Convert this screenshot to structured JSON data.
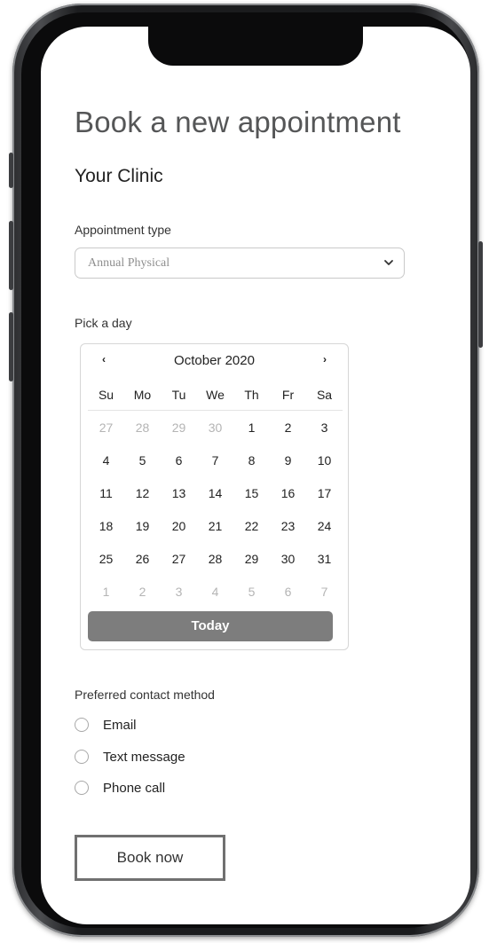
{
  "page": {
    "title": "Book a new appointment",
    "clinic": "Your Clinic"
  },
  "appointment_type": {
    "label": "Appointment type",
    "selected": "Annual Physical"
  },
  "date_picker": {
    "label": "Pick a day",
    "month_label": "October 2020",
    "prev_symbol": "‹",
    "next_symbol": "›",
    "weekdays": [
      "Su",
      "Mo",
      "Tu",
      "We",
      "Th",
      "Fr",
      "Sa"
    ],
    "weeks": [
      [
        {
          "d": "27",
          "muted": true
        },
        {
          "d": "28",
          "muted": true
        },
        {
          "d": "29",
          "muted": true
        },
        {
          "d": "30",
          "muted": true
        },
        {
          "d": "1"
        },
        {
          "d": "2"
        },
        {
          "d": "3"
        }
      ],
      [
        {
          "d": "4"
        },
        {
          "d": "5"
        },
        {
          "d": "6"
        },
        {
          "d": "7"
        },
        {
          "d": "8"
        },
        {
          "d": "9"
        },
        {
          "d": "10"
        }
      ],
      [
        {
          "d": "11"
        },
        {
          "d": "12"
        },
        {
          "d": "13"
        },
        {
          "d": "14"
        },
        {
          "d": "15"
        },
        {
          "d": "16"
        },
        {
          "d": "17"
        }
      ],
      [
        {
          "d": "18"
        },
        {
          "d": "19"
        },
        {
          "d": "20"
        },
        {
          "d": "21"
        },
        {
          "d": "22"
        },
        {
          "d": "23"
        },
        {
          "d": "24"
        }
      ],
      [
        {
          "d": "25"
        },
        {
          "d": "26"
        },
        {
          "d": "27"
        },
        {
          "d": "28"
        },
        {
          "d": "29"
        },
        {
          "d": "30"
        },
        {
          "d": "31"
        }
      ],
      [
        {
          "d": "1",
          "muted": true
        },
        {
          "d": "2",
          "muted": true
        },
        {
          "d": "3",
          "muted": true
        },
        {
          "d": "4",
          "muted": true
        },
        {
          "d": "5",
          "muted": true
        },
        {
          "d": "6",
          "muted": true
        },
        {
          "d": "7",
          "muted": true
        }
      ]
    ],
    "today_label": "Today"
  },
  "contact": {
    "label": "Preferred contact method",
    "options": [
      "Email",
      "Text message",
      "Phone call"
    ]
  },
  "actions": {
    "book_label": "Book now"
  },
  "icons": {
    "select": "chevron-down-icon",
    "calendar_prev": "chevron-left-icon",
    "calendar_next": "chevron-right-icon"
  },
  "colors": {
    "today_button": "#7d7d7d",
    "title_text": "#555657",
    "book_border": "#707070"
  }
}
